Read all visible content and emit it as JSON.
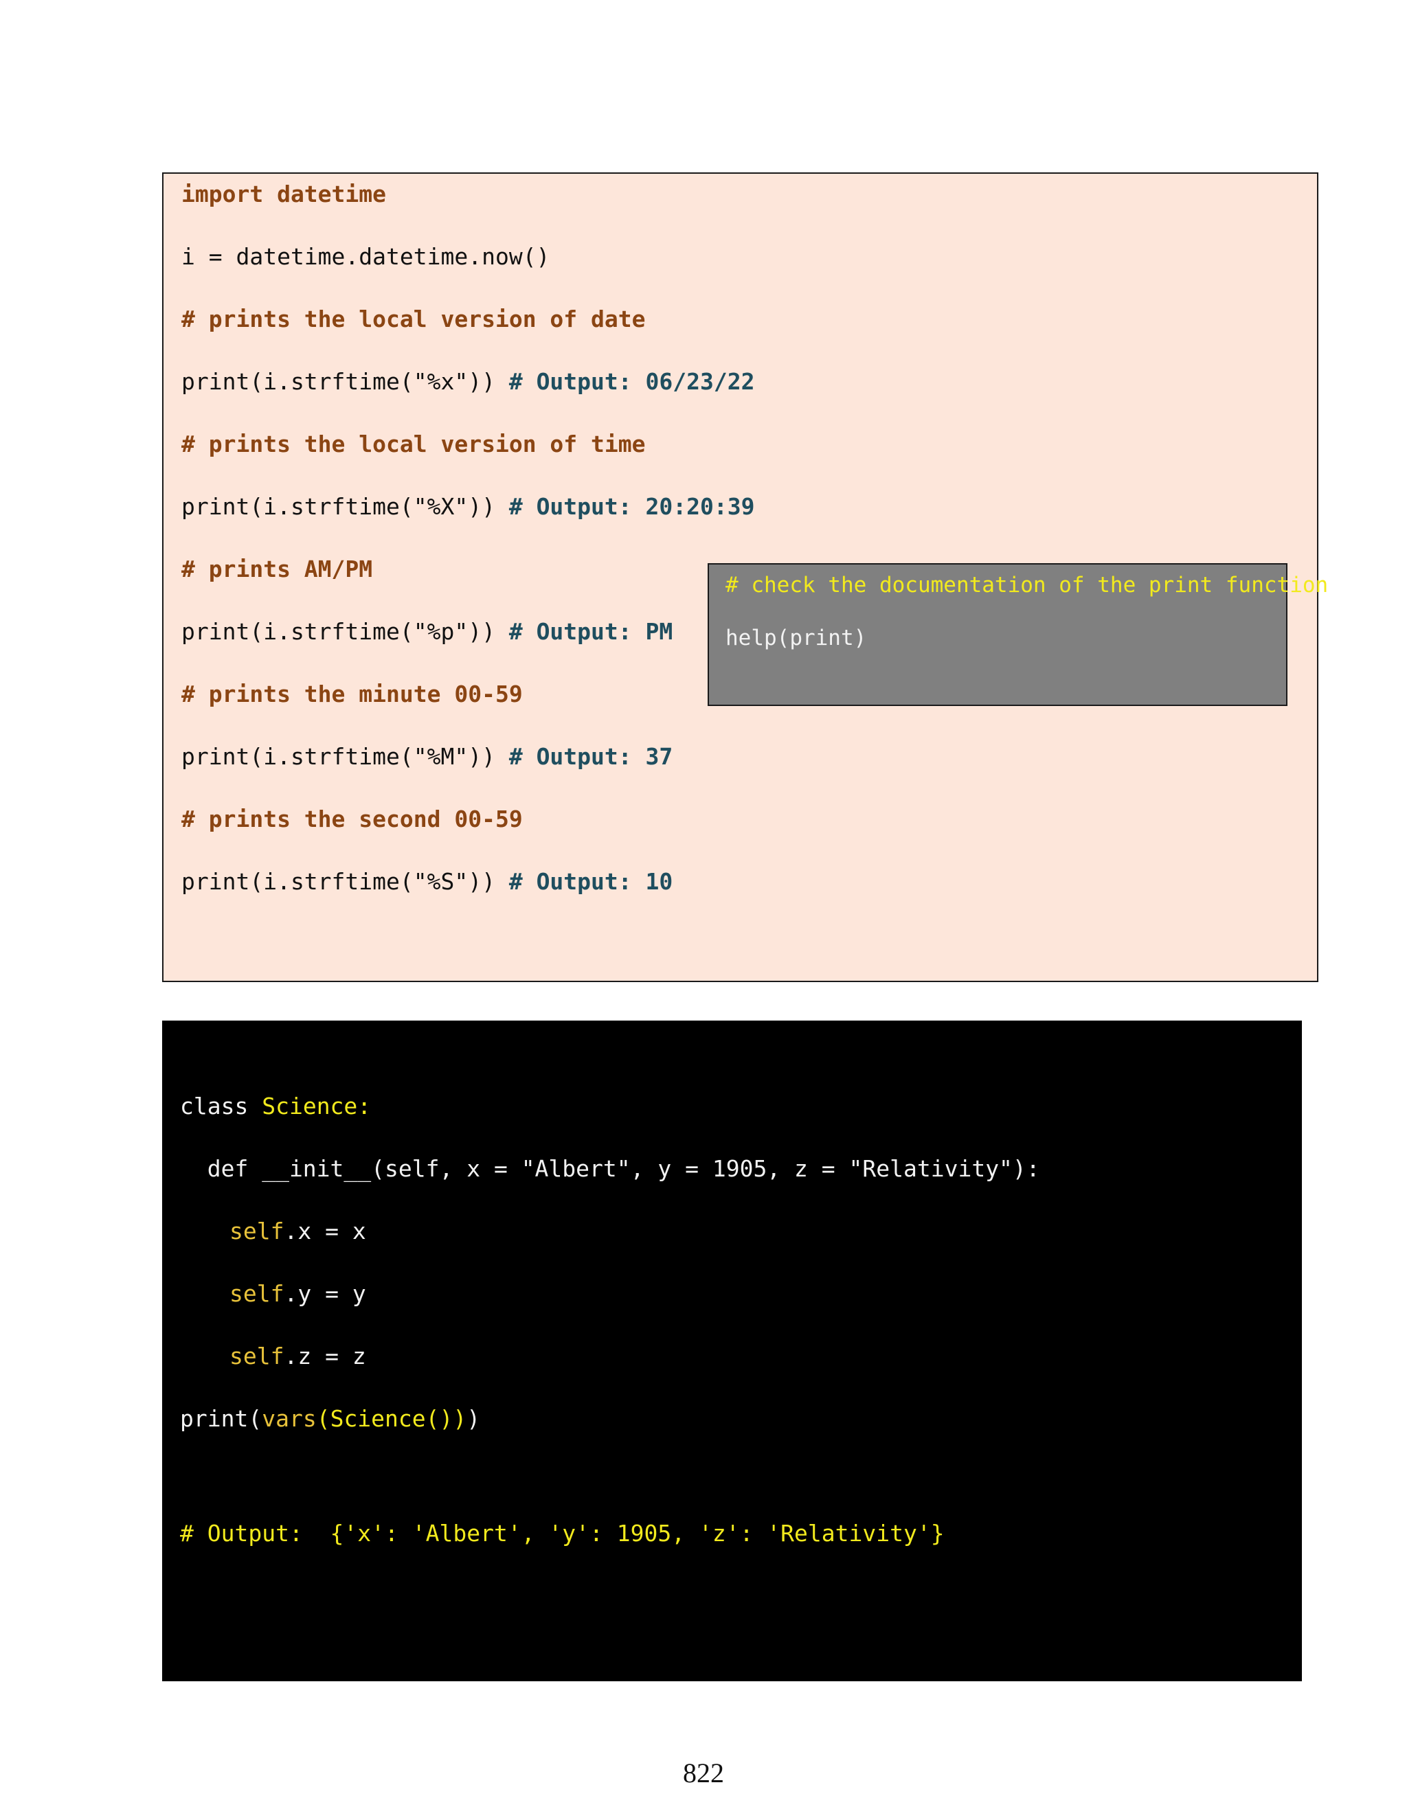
{
  "datetime_block": {
    "import_line": "import datetime",
    "assign_line": "i = datetime.datetime.now()",
    "c_date": "# prints the local version of date",
    "p_date": "print(i.strftime(\"%x\")) ",
    "o_date": "# Output: 06/23/22",
    "c_time": "# prints the local version of time",
    "p_time": "print(i.strftime(\"%X\")) ",
    "o_time": "# Output: 20:20:39",
    "c_ampm": "# prints AM/PM",
    "p_ampm": "print(i.strftime(\"%p\")) ",
    "o_ampm": "# Output: PM",
    "c_minute": "# prints the minute 00-59",
    "p_minute": "print(i.strftime(\"%M\")) ",
    "o_minute": "# Output: 37",
    "c_second": "# prints the second 00-59",
    "p_second": "print(i.strftime(\"%S\")) ",
    "o_second": "# Output: 10"
  },
  "help_block": {
    "comment": "# check the documentation of the print function",
    "code": "help(print)"
  },
  "science_block": {
    "class_kw": "class ",
    "class_name": "Science:",
    "def_line": "  def __init__(self, x = \"Albert\", y = 1905, z = \"Relativity\"):",
    "self_kw": "self",
    "self_x_rest": ".x = x",
    "self_y_rest": ".y = y",
    "self_z_rest": ".z = z",
    "print_open": "print(",
    "vars_fn": "vars",
    "vars_arg": "(Science())",
    "print_close": ")",
    "output_comment": "# Output:  {'x': 'Albert', 'y': 1905, 'z': 'Relativity'}"
  },
  "footer": {
    "page_number": "822"
  },
  "colors": {
    "datetime_bg": "#fde6da",
    "comment": "#8b4513",
    "output": "#1f4e5f",
    "help_bg": "#808080",
    "science_bg": "#000000",
    "yellow": "#f2ea1d",
    "gold": "#e8c23a"
  }
}
